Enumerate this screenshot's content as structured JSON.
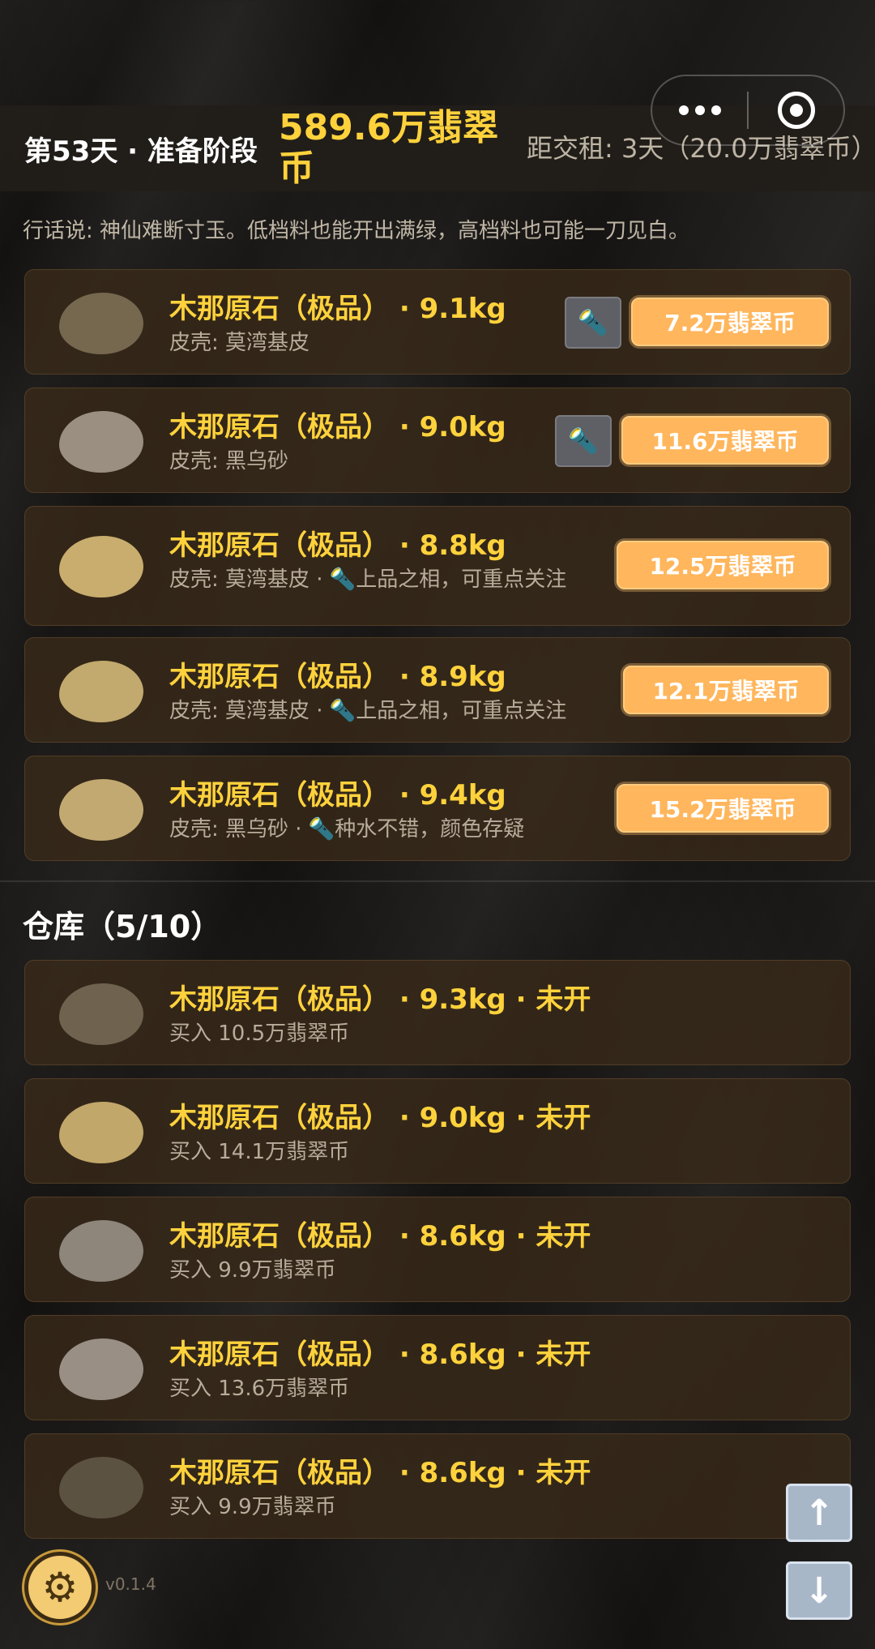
{
  "header": {
    "day": "第53天 · 准备阶段",
    "money": "589.6万翡翠币",
    "rent": "距交租: 3天（20.0万翡翠币）"
  },
  "tip": "行话说: 神仙难断寸玉。低档料也能开出满绿，高档料也可能一刀见白。",
  "market": [
    {
      "name": "木那原石（极品） · 9.1kg",
      "sub": "皮壳: 莫湾基皮",
      "price": "7.2万翡翠币",
      "flashlight": true,
      "stone_color": "#75684f"
    },
    {
      "name": "木那原石（极品） · 9.0kg",
      "sub": "皮壳: 黑乌砂",
      "price": "11.6万翡翠币",
      "flashlight": true,
      "stone_color": "#9a8f81"
    },
    {
      "name": "木那原石（极品） · 8.8kg",
      "sub": "皮壳: 莫湾基皮 · 🔦上品之相，可重点关注",
      "price": "12.5万翡翠币",
      "flashlight": false,
      "stone_color": "#c8ad6e"
    },
    {
      "name": "木那原石（极品） · 8.9kg",
      "sub": "皮壳: 莫湾基皮 · 🔦上品之相，可重点关注",
      "price": "12.1万翡翠币",
      "flashlight": false,
      "stone_color": "#c2a96e"
    },
    {
      "name": "木那原石（极品） · 9.4kg",
      "sub": "皮壳: 黑乌砂 · 🔦种水不错，颜色存疑",
      "price": "15.2万翡翠币",
      "flashlight": false,
      "stone_color": "#c2a971"
    }
  ],
  "warehouse": {
    "title": "仓库（5/10）",
    "items": [
      {
        "name": "木那原石（极品） · 9.3kg · 未开",
        "sub": "买入 10.5万翡翠币",
        "stone_color": "#6f6350"
      },
      {
        "name": "木那原石（极品） · 9.0kg · 未开",
        "sub": "买入 14.1万翡翠币",
        "stone_color": "#c2a76a"
      },
      {
        "name": "木那原石（极品） · 8.6kg · 未开",
        "sub": "买入 9.9万翡翠币",
        "stone_color": "#8e857b"
      },
      {
        "name": "木那原石（极品） · 8.6kg · 未开",
        "sub": "买入 13.6万翡翠币",
        "stone_color": "#9a8f84"
      },
      {
        "name": "木那原石（极品） · 8.6kg · 未开",
        "sub": "买入 9.9万翡翠币",
        "stone_color": "#5c5242"
      }
    ]
  },
  "footer": {
    "version": "v0.1.4",
    "gear_icon": "⚙",
    "scroll_up_icon": "↑",
    "scroll_down_icon": "↓"
  }
}
